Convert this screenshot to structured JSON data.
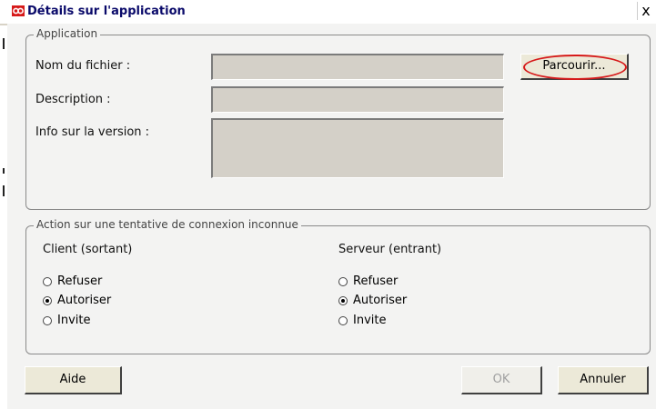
{
  "window": {
    "title": "Détails sur l'application",
    "close_label": "x"
  },
  "application_group": {
    "legend": "Application",
    "filename_label": "Nom du fichier :",
    "description_label": "Description :",
    "version_label": "Info sur la version :",
    "filename_value": "",
    "description_value": "",
    "version_value": "",
    "browse_label": "Parcourir..."
  },
  "action_group": {
    "legend": "Action sur une tentative de connexion inconnue",
    "client": {
      "title": "Client (sortant)",
      "options": [
        "Refuser",
        "Autoriser",
        "Invite"
      ],
      "selected": "Autoriser"
    },
    "server": {
      "title": "Serveur (entrant)",
      "options": [
        "Refuser",
        "Autoriser",
        "Invite"
      ],
      "selected": "Autoriser"
    }
  },
  "buttons": {
    "help": "Aide",
    "ok": "OK",
    "cancel": "Annuler"
  },
  "colors": {
    "title_text": "#0a0a6a",
    "highlight_ring": "#d61a1a",
    "app_icon": "#d61a1a"
  }
}
